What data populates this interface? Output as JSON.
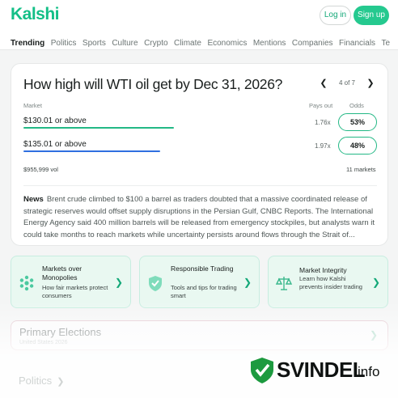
{
  "header": {
    "logo": "Kalshi",
    "login_label": "Log in",
    "signup_label": "Sign up",
    "brand_color": "#13bf87"
  },
  "nav": {
    "items": [
      "Trending",
      "Politics",
      "Sports",
      "Culture",
      "Crypto",
      "Climate",
      "Economics",
      "Mentions",
      "Companies",
      "Financials",
      "Te"
    ],
    "active": "Trending"
  },
  "market": {
    "title": "How high will WTI oil get by Dec 31, 2026?",
    "pager": "4 of 7",
    "col_market": "Market",
    "col_pays": "Pays out",
    "col_odds": "Odds",
    "rows": [
      {
        "label": "$130.01 or above",
        "pays": "1.76x",
        "odds": "53%",
        "color": "#23b885"
      },
      {
        "label": "$135.01 or above",
        "pays": "1.97x",
        "odds": "48%",
        "color": "#2f6fe0"
      }
    ],
    "volume": "$955,999 vol",
    "markets_count": "11 markets",
    "news_label": "News",
    "news_text": "Brent crude climbed to $100 a barrel as traders doubted that a massive coordinated release of strategic reserves would offset supply disruptions in the Persian Gulf, CNBC Reports. The International Energy Agency said 400 million barrels will be released from emergency stockpiles, but analysts warn it could take months to reach markets while uncertainty persists around flows through the Strait of..."
  },
  "promos": [
    {
      "title": "Markets over Monopolies",
      "subtitle": "How fair markets protect consumers",
      "icon": "snowflake-icon"
    },
    {
      "title": "Responsible Trading",
      "subtitle": "Tools and tips for trading smart",
      "icon": "shield-check-icon"
    },
    {
      "title": "Market Integrity",
      "subtitle": "Learn how Kalshi prevents insider trading",
      "icon": "scales-icon"
    }
  ],
  "primary": {
    "title": "Primary Elections",
    "subtitle": "United States 2026"
  },
  "politics_heading": "Politics",
  "watermark": {
    "word": "SVINDEL",
    "suffix": "info"
  }
}
